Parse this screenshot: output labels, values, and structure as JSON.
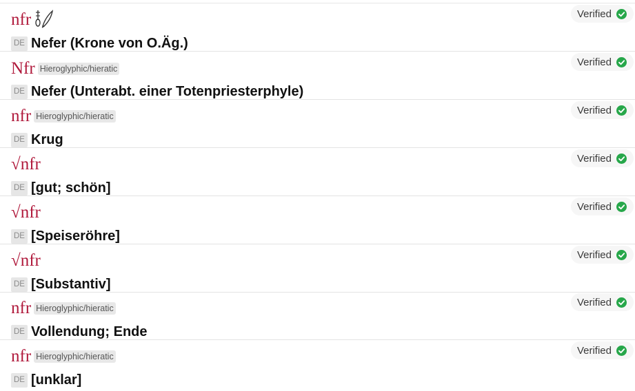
{
  "status_label": "Verified",
  "lang_label": "DE",
  "colors": {
    "transliteration": "#b01a3c",
    "verified_check": "#27a74a"
  },
  "entries": [
    {
      "translit": "nfr",
      "tag": "",
      "has_hieroglyph_icons": true,
      "meaning": "Nefer (Krone von O.Äg.)"
    },
    {
      "translit": "Nfr",
      "tag": "Hieroglyphic/hieratic",
      "has_hieroglyph_icons": false,
      "meaning": "Nefer (Unterabt. einer Totenpriesterphyle)"
    },
    {
      "translit": "nfr",
      "tag": "Hieroglyphic/hieratic",
      "has_hieroglyph_icons": false,
      "meaning": "Krug"
    },
    {
      "translit": "√nfr",
      "tag": "",
      "has_hieroglyph_icons": false,
      "meaning": "[gut; schön]"
    },
    {
      "translit": "√nfr",
      "tag": "",
      "has_hieroglyph_icons": false,
      "meaning": "[Speiseröhre]"
    },
    {
      "translit": "√nfr",
      "tag": "",
      "has_hieroglyph_icons": false,
      "meaning": "[Substantiv]"
    },
    {
      "translit": "nfr",
      "tag": "Hieroglyphic/hieratic",
      "has_hieroglyph_icons": false,
      "meaning": "Vollendung; Ende"
    },
    {
      "translit": "nfr",
      "tag": "Hieroglyphic/hieratic",
      "has_hieroglyph_icons": false,
      "meaning": "[unklar]"
    }
  ]
}
